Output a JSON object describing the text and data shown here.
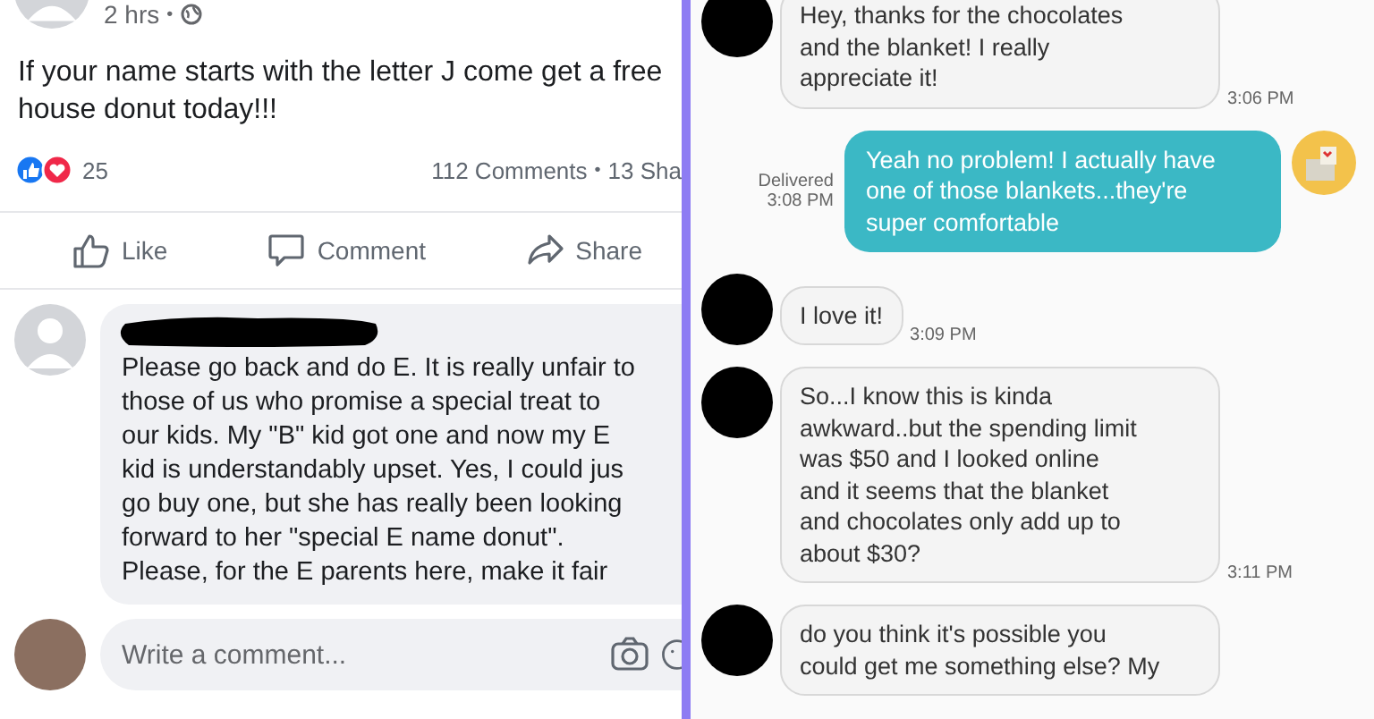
{
  "post": {
    "time": "2 hrs",
    "separator": "•",
    "body": [
      "If your name starts with the letter J come get a free",
      "house donut today!!!"
    ],
    "reaction_count": "25",
    "comments_count": "112 Comments",
    "shares_count": "13 Sha",
    "actions": [
      {
        "kind": "like",
        "label": "Like"
      },
      {
        "kind": "comment",
        "label": "Comment"
      },
      {
        "kind": "share",
        "label": "Share"
      }
    ],
    "comment": {
      "lines": [
        "Please go back and do E. It is really unfair to",
        "those of us who promise a special treat to",
        "our kids. My \"B\" kid got one and now my E",
        "kid is understandably upset. Yes, I could jus",
        "go buy one, but she has really been looking",
        "forward to her \"special E name donut\".",
        "Please, for the E parents here, make it fair"
      ]
    },
    "composer": {
      "placeholder": "Write a comment..."
    }
  },
  "chat": {
    "messages": [
      {
        "kind": "received",
        "lines": [
          "Hey, thanks for the chocolates",
          "and the blanket! I really",
          "appreciate it!"
        ],
        "time": "3:06 PM"
      },
      {
        "kind": "sent",
        "lines": [
          "Yeah no problem! I actually have",
          "one of those blankets...they're",
          "super comfortable"
        ],
        "status": "Delivered",
        "time": "3:08 PM"
      },
      {
        "kind": "received",
        "lines": [
          "I love it!"
        ],
        "time": "3:09 PM"
      },
      {
        "kind": "received",
        "lines": [
          "So...I know this is kinda",
          "awkward..but the spending limit",
          "was $50 and I looked online",
          "and it seems that the blanket",
          "and chocolates only add up to",
          "about $30?"
        ],
        "time": "3:11 PM"
      },
      {
        "kind": "received",
        "lines": [
          "do you think it's possible you",
          "could get me something else? My"
        ]
      }
    ]
  }
}
